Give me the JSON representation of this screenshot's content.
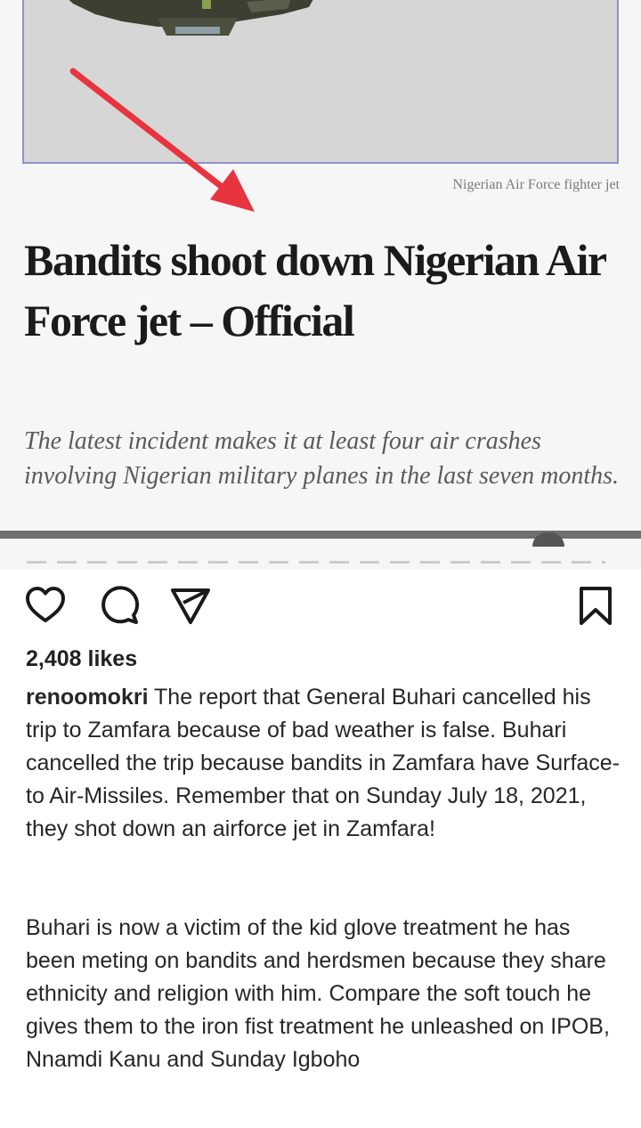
{
  "article": {
    "photo_caption": "Nigerian Air Force fighter jet",
    "headline": "Bandits shoot down Nigerian Air Force jet – Official",
    "dek": "The latest incident makes it at least four air crashes involving Nigerian military planes in the last seven months.",
    "arrow_color": "#e8343e"
  },
  "actions": {
    "like_icon": "heart-icon",
    "comment_icon": "comment-icon",
    "share_icon": "send-icon",
    "save_icon": "bookmark-icon"
  },
  "post": {
    "likes": "2,408 likes",
    "username": "renoomokri",
    "caption_p1": " The report that General Buhari cancelled his trip to Zamfara because of bad weather is false. Buhari cancelled the trip because bandits in Zamfara have Surface-to Air-Missiles. Remember that on Sunday July 18, 2021, they shot down an airforce jet in Zamfara!",
    "caption_p2": "Buhari is now a victim of the kid glove treatment he has been meting on bandits and herdsmen because they share ethnicity and religion with him. Compare the soft touch he gives them to the iron fist treatment he unleashed on IPOB, Nnamdi Kanu and Sunday Igboho"
  }
}
